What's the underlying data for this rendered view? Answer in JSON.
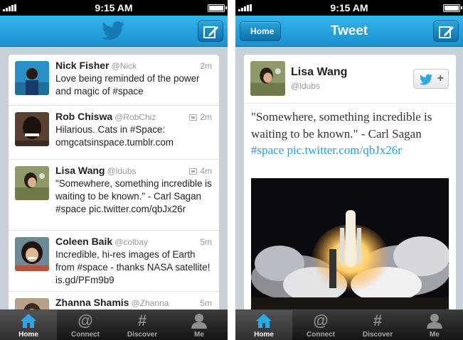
{
  "status_bar": {
    "time": "9:15 AM"
  },
  "left": {
    "tweets": [
      {
        "name": "Nick Fisher",
        "handle": "@Nick",
        "time": "2m",
        "text": "Love being reminded of the power and magic of #space",
        "media": false
      },
      {
        "name": "Rob Chiswa",
        "handle": "@RobChiz",
        "time": "2m",
        "text": "Hilarious. Cats in #Space: omgcatsinspace.tumblr.com",
        "media": true
      },
      {
        "name": "Lisa Wang",
        "handle": "@ldubs",
        "time": "4m",
        "text": "\"Somewhere, something incredible is waiting to be known.\" - Carl Sagan #space pic.twitter.com/qbJx26r",
        "media": true
      },
      {
        "name": "Coleen Baik",
        "handle": "@colbay",
        "time": "5m",
        "text": "Incredible, hi-res images of Earth from #space - thanks NASA satellite! is.gd/PFm9b9",
        "media": false
      },
      {
        "name": "Zhanna Shamis",
        "handle": "@Zhanna",
        "time": "5m",
        "text": "",
        "media": false
      }
    ]
  },
  "right": {
    "back_label": "Home",
    "title": "Tweet",
    "tweet": {
      "name": "Lisa Wang",
      "handle": "@ldubs",
      "quote": "\"Somewhere, something incredible is waiting to be known.\" - Carl Sagan ",
      "link": "#space pic.twitter.com/qbJx26r"
    }
  },
  "tabs": [
    {
      "label": "Home",
      "icon": "home-icon"
    },
    {
      "label": "Connect",
      "icon": "at-icon"
    },
    {
      "label": "Discover",
      "icon": "hash-icon"
    },
    {
      "label": "Me",
      "icon": "person-icon"
    }
  ],
  "colors": {
    "accent": "#1a91cf",
    "link": "#2b9cd8",
    "nav_top": "#34b5ea"
  }
}
